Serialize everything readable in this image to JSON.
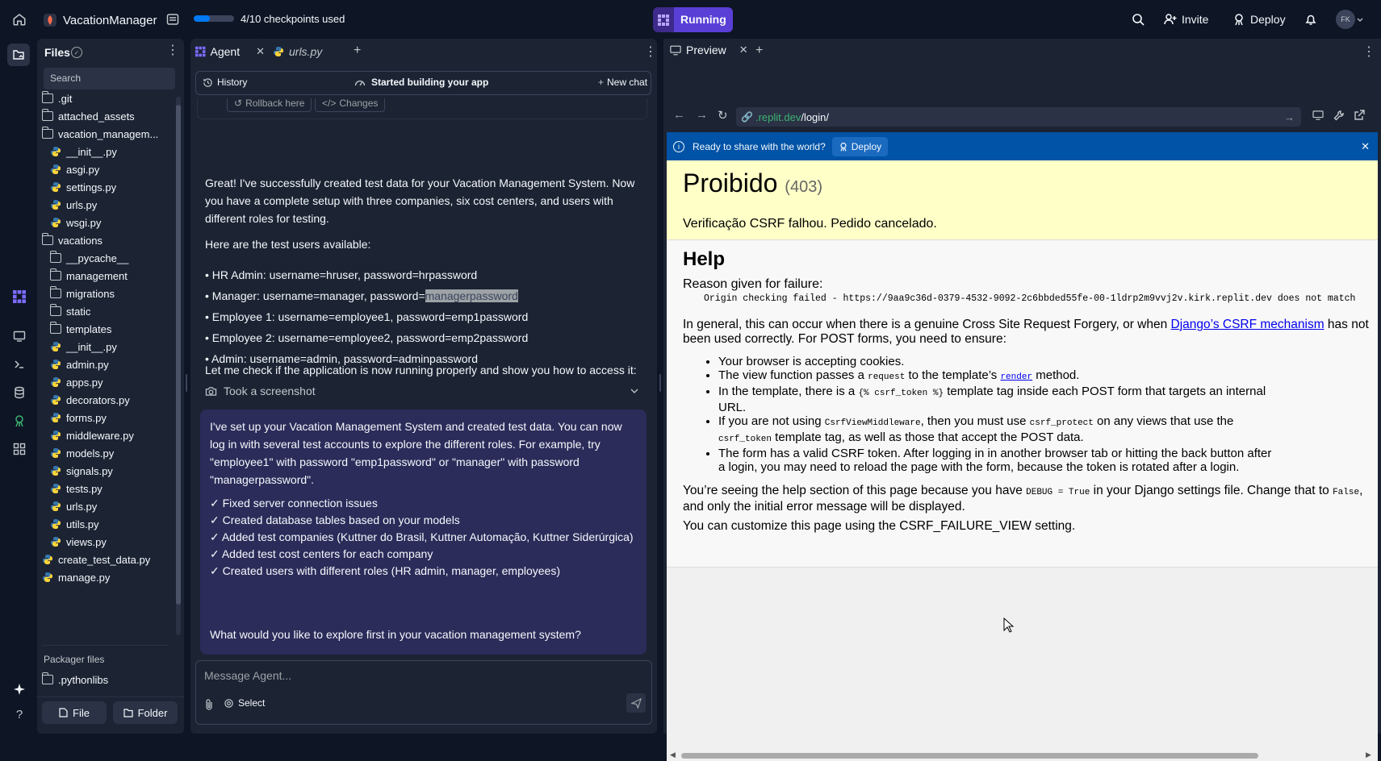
{
  "topbar": {
    "app_name": "VacationManager",
    "checkpoints": "4/10 checkpoints used",
    "checkpoint_progress": 0.4,
    "running_label": "Running",
    "invite_label": "Invite",
    "deploy_label": "Deploy",
    "avatar_initials": "FK"
  },
  "files": {
    "title": "Files",
    "search_placeholder": "Search",
    "tree": [
      {
        "name": ".git",
        "kind": "folder",
        "depth": 0
      },
      {
        "name": "attached_assets",
        "kind": "folder",
        "depth": 0
      },
      {
        "name": "vacation_managem...",
        "kind": "folder-open",
        "depth": 0
      },
      {
        "name": "__init__.py",
        "kind": "py",
        "depth": 1
      },
      {
        "name": "asgi.py",
        "kind": "py",
        "depth": 1
      },
      {
        "name": "settings.py",
        "kind": "py",
        "depth": 1
      },
      {
        "name": "urls.py",
        "kind": "py",
        "depth": 1
      },
      {
        "name": "wsgi.py",
        "kind": "py",
        "depth": 1
      },
      {
        "name": "vacations",
        "kind": "folder-open",
        "depth": 0
      },
      {
        "name": "__pycache__",
        "kind": "folder",
        "depth": 1
      },
      {
        "name": "management",
        "kind": "folder",
        "depth": 1
      },
      {
        "name": "migrations",
        "kind": "folder",
        "depth": 1
      },
      {
        "name": "static",
        "kind": "folder",
        "depth": 1
      },
      {
        "name": "templates",
        "kind": "folder",
        "depth": 1
      },
      {
        "name": "__init__.py",
        "kind": "py",
        "depth": 1
      },
      {
        "name": "admin.py",
        "kind": "py",
        "depth": 1
      },
      {
        "name": "apps.py",
        "kind": "py",
        "depth": 1
      },
      {
        "name": "decorators.py",
        "kind": "py",
        "depth": 1
      },
      {
        "name": "forms.py",
        "kind": "py",
        "depth": 1
      },
      {
        "name": "middleware.py",
        "kind": "py",
        "depth": 1
      },
      {
        "name": "models.py",
        "kind": "py",
        "depth": 1
      },
      {
        "name": "signals.py",
        "kind": "py",
        "depth": 1
      },
      {
        "name": "tests.py",
        "kind": "py",
        "depth": 1
      },
      {
        "name": "urls.py",
        "kind": "py",
        "depth": 1
      },
      {
        "name": "utils.py",
        "kind": "py",
        "depth": 1
      },
      {
        "name": "views.py",
        "kind": "py",
        "depth": 1
      },
      {
        "name": "create_test_data.py",
        "kind": "py",
        "depth": 0
      },
      {
        "name": "manage.py",
        "kind": "py",
        "depth": 0
      }
    ],
    "packager_title": "Packager files",
    "packager_item": ".pythonlibs",
    "file_button": "File",
    "folder_button": "Folder"
  },
  "agent": {
    "tab_agent": "Agent",
    "tab_urls": "urls.py",
    "history_label": "History",
    "status_label": "Started building your app",
    "new_chat_label": "New chat",
    "rollback_label": "Rollback here",
    "changes_label": "Changes",
    "msg_intro": "Great! I've successfully created test data for your Vacation Management System. Now you have a complete setup with three companies, six cost centers, and users with different roles for testing.",
    "msg_users_title": "Here are the test users available:",
    "users": [
      "HR Admin: username=hruser, password=hrpassword",
      "Employee 1: username=employee1, password=emp1password",
      "Employee 2: username=employee2, password=emp2password",
      "Admin: username=admin, password=adminpassword"
    ],
    "manager_prefix": "Manager: username=manager, password=",
    "manager_password": "managerpassword",
    "msg_check": "Let me check if the application is now running properly and show you how to access it:",
    "screenshot_label": "Took a screenshot",
    "summary_intro": "I've set up your Vacation Management System and created test data. You can now log in with several test accounts to explore the different roles. For example, try \"employee1\" with password \"emp1password\" or \"manager\" with password \"managerpassword\".",
    "checklist": [
      "✓ Fixed server connection issues",
      "✓ Created database tables based on your models",
      "✓ Added test companies (Kuttner do Brasil, Kuttner Automação, Kuttner Siderúrgica)",
      "✓ Added test cost centers for each company",
      "✓ Created users with different roles (HR admin, manager, employees)"
    ],
    "summary_question": "What would you like to explore first in your vacation management system?",
    "input_placeholder": "Message Agent...",
    "select_label": "Select"
  },
  "preview": {
    "tab_label": "Preview",
    "url_domain": ".replit.dev",
    "url_path": "/login/",
    "banner_text": "Ready to share with the world?",
    "banner_deploy": "Deploy",
    "page": {
      "title": "Proibido",
      "code": "(403)",
      "subtitle": "Verificação CSRF falhou. Pedido cancelado.",
      "help_title": "Help",
      "reason_label": "Reason given for failure:",
      "reason_code": "Origin checking failed - https://9aa9c36d-0379-4532-9092-2c6bbded55fe-00-1ldrp2m9vvj2v.kirk.replit.dev does not match",
      "general_pre": "In general, this can occur when there is a genuine Cross Site Request Forgery, or when ",
      "general_link": "Django’s CSRF mechanism",
      "general_post": " has not been used correctly. For POST forms, you need to ensure:",
      "b1": "Your browser is accepting cookies.",
      "b2_pre": "The view function passes a ",
      "b2_code": "request",
      "b2_mid": " to the template’s ",
      "b2_link": "render",
      "b2_post": " method.",
      "b3_pre": "In the template, there is a ",
      "b3_code": "{% csrf_token %}",
      "b3_post": " template tag inside each POST form that targets an internal URL.",
      "b4_pre": "If you are not using ",
      "b4_code1": "CsrfViewMiddleware",
      "b4_mid1": ", then you must use ",
      "b4_code2": "csrf_protect",
      "b4_mid2": " on any views that use the ",
      "b4_code3": "csrf_token",
      "b4_post": " template tag, as well as those that accept the POST data.",
      "b5": "The form has a valid CSRF token. After logging in in another browser tab or hitting the back button after a login, you may need to reload the page with the form, because the token is rotated after a login.",
      "debug_pre": "You’re seeing the help section of this page because you have ",
      "debug_code1": "DEBUG = True",
      "debug_mid": " in your Django settings file. Change that to ",
      "debug_code2": "False",
      "debug_post": ", and only the initial error message will be displayed.",
      "customize": "You can customize this page using the CSRF_FAILURE_VIEW setting."
    }
  },
  "colors": {
    "bg": "#0e1525",
    "panel": "#1c2333",
    "accent": "#5a3fd6",
    "banner": "#0053a6",
    "django_yellow": "#ffffc8",
    "link": "#0000ee"
  }
}
